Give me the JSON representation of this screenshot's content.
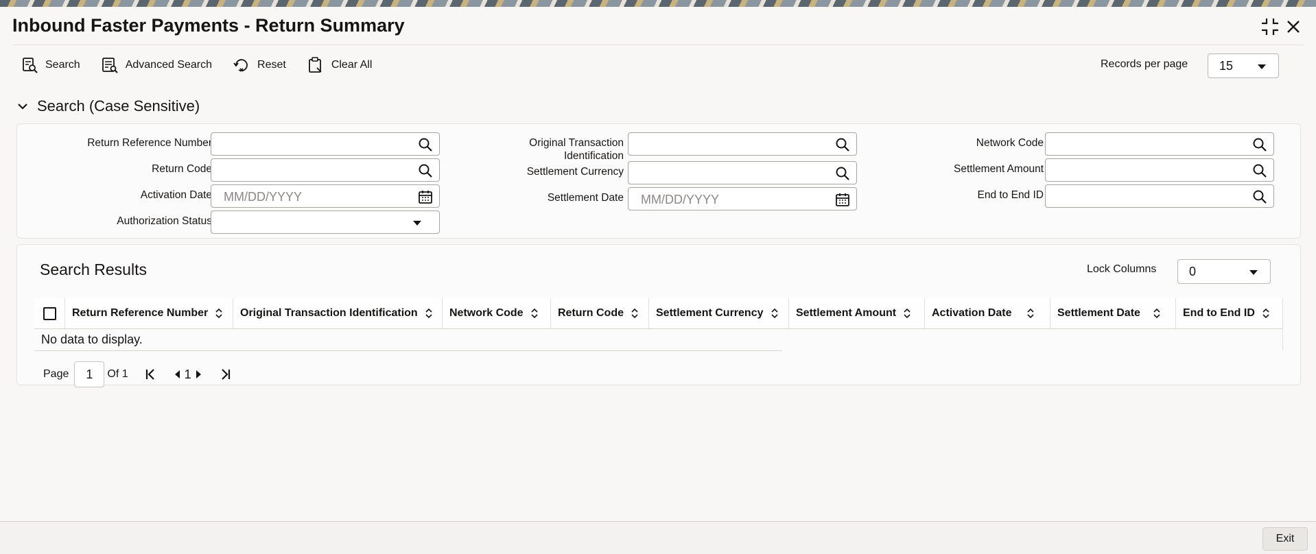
{
  "window": {
    "title": "Inbound Faster Payments - Return Summary",
    "maximize_icon": "maximize-icon",
    "close_icon": "close-icon"
  },
  "toolbar": {
    "search_label": "Search",
    "advanced_search_label": "Advanced Search",
    "reset_label": "Reset",
    "clear_all_label": "Clear All"
  },
  "records_per_page": {
    "label": "Records per page",
    "value": "15"
  },
  "search_section": {
    "title": "Search (Case Sensitive)",
    "fields": {
      "return_reference_number": {
        "label": "Return Reference Number",
        "value": ""
      },
      "return_code": {
        "label": "Return Code",
        "value": ""
      },
      "activation_date": {
        "label": "Activation Date",
        "placeholder": "MM/DD/YYYY"
      },
      "authorization_status": {
        "label": "Authorization Status",
        "value": ""
      },
      "original_transaction_identification": {
        "label_line1": "Original Transaction",
        "label_line2": "Identification",
        "value": ""
      },
      "settlement_currency": {
        "label": "Settlement Currency",
        "value": ""
      },
      "settlement_date": {
        "label": "Settlement Date",
        "placeholder": "MM/DD/YYYY"
      },
      "network_code": {
        "label": "Network Code",
        "value": ""
      },
      "settlement_amount": {
        "label": "Settlement Amount",
        "value": ""
      },
      "end_to_end_id": {
        "label": "End to End ID",
        "value": ""
      }
    }
  },
  "results": {
    "title": "Search Results",
    "lock_columns": {
      "label": "Lock Columns",
      "value": "0"
    },
    "columns": [
      "Return Reference Number",
      "Original Transaction Identification",
      "Network Code",
      "Return Code",
      "Settlement Currency",
      "Settlement Amount",
      "Activation Date",
      "Settlement Date",
      "End to End ID"
    ],
    "empty_message": "No data to display."
  },
  "pagination": {
    "page_label": "Page",
    "current_page": "1",
    "of_label": "Of 1",
    "nav_page": "1"
  },
  "footer": {
    "exit_label": "Exit"
  },
  "colors": {
    "accent": "#161513",
    "background": "#f8f7f6",
    "border": "#a9a6a1"
  }
}
